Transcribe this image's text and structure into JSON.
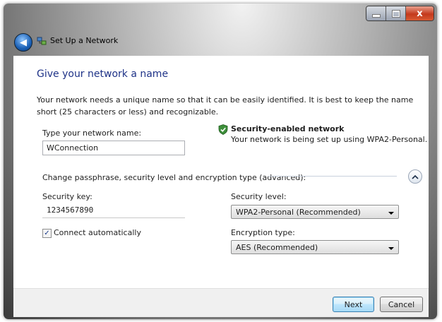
{
  "window": {
    "title": "Set Up a Network",
    "controls": {
      "close_glyph": "x"
    }
  },
  "page": {
    "heading": "Give your network a name",
    "description": "Your network needs a unique name so that it can be easily identified. It is best to keep the name short (25 characters or less) and recognizable."
  },
  "network_name": {
    "label": "Type your network name:",
    "value": "WConnection"
  },
  "security_info": {
    "icon": "shield-check-icon",
    "title": "Security-enabled network",
    "subtitle": "Your network is being set up using WPA2-Personal."
  },
  "advanced": {
    "label": "Change passphrase, security level and encryption type (advanced):",
    "expander_icon": "chevron-up-icon"
  },
  "security_key": {
    "label": "Security key:",
    "value": "1234567890"
  },
  "connect_auto": {
    "label": "Connect automatically",
    "checked": true
  },
  "security_level": {
    "label": "Security level:",
    "selected": "WPA2-Personal (Recommended)"
  },
  "encryption_type": {
    "label": "Encryption type:",
    "selected": "AES (Recommended)"
  },
  "footer": {
    "next_label": "Next",
    "cancel_label": "Cancel"
  },
  "colors": {
    "heading": "#1e3287",
    "close_button": "#c4391c",
    "primary_button": "#bee6fd"
  }
}
